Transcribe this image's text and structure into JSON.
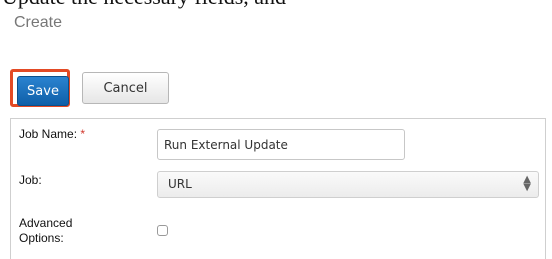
{
  "clip_text": "Update the necessary fields, and",
  "page_title": "Create",
  "toolbar": {
    "save_label": "Save",
    "cancel_label": "Cancel"
  },
  "form": {
    "job_name": {
      "label": "Job Name:",
      "required_mark": "*",
      "value": "Run External Update"
    },
    "job": {
      "label": "Job:",
      "selected": "URL"
    },
    "advanced": {
      "label_line1": "Advanced",
      "label_line2": "Options:",
      "checked": false
    }
  },
  "colors": {
    "save_button": "#1265b0",
    "highlight_border": "#e34a25",
    "required": "#d0362b",
    "title": "#777777"
  }
}
